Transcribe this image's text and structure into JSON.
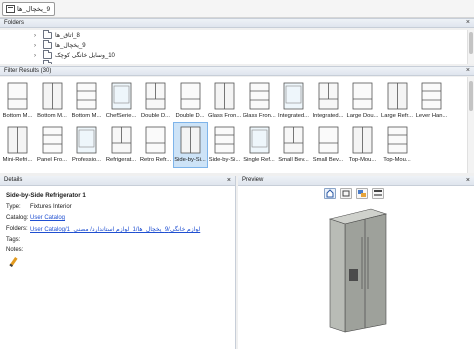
{
  "toolbar": {
    "crumb": "9_یخچال_ها"
  },
  "folders": {
    "title": "Folders",
    "items": [
      {
        "label": "8_اتاق_ها"
      },
      {
        "label": "9_یخچال_ها"
      },
      {
        "label": "10_وسایل خانگی کوچک"
      },
      {
        "label": "..."
      }
    ]
  },
  "filter": {
    "title": "Filter Results (30)",
    "row1": [
      "Bottom M...",
      "Bottom M...",
      "Bottom M...",
      "ChefSerie...",
      "Double D...",
      "Double D...",
      "Glass Fron...",
      "Glass Fron...",
      "Integrated...",
      "Integrated...",
      "Large Dou...",
      "Large Refr...",
      "Lever Han..."
    ],
    "row2": [
      "Mini-Refri...",
      "Panel Fro...",
      "Professio...",
      "Refrigerat...",
      "Retro Refr...",
      "Side-by-Si...",
      "Side-by-Si...",
      "Single Ref...",
      "Small Bev...",
      "Small Bev...",
      "Top-Mou...",
      "Top-Mou..."
    ]
  },
  "details": {
    "header": "Details",
    "title": "Side-by-Side Refrigerator 1",
    "type_key": "Type:",
    "type_val": "Fixtures Interior",
    "catalog_key": "Catalog:",
    "catalog_val": "User Catalog",
    "folders_key": "Folders:",
    "folders_val": "User Catalog/1_لوازم خانگی/9_یخچال_ها/1_لوازم استاندارد/ مصنی",
    "tags_key": "Tags:",
    "notes_key": "Notes:"
  },
  "preview": {
    "header": "Preview"
  },
  "colors": {
    "accent": "#1f4fd1",
    "selection": "#cde3f7",
    "fridge": "#b9bcb6"
  }
}
